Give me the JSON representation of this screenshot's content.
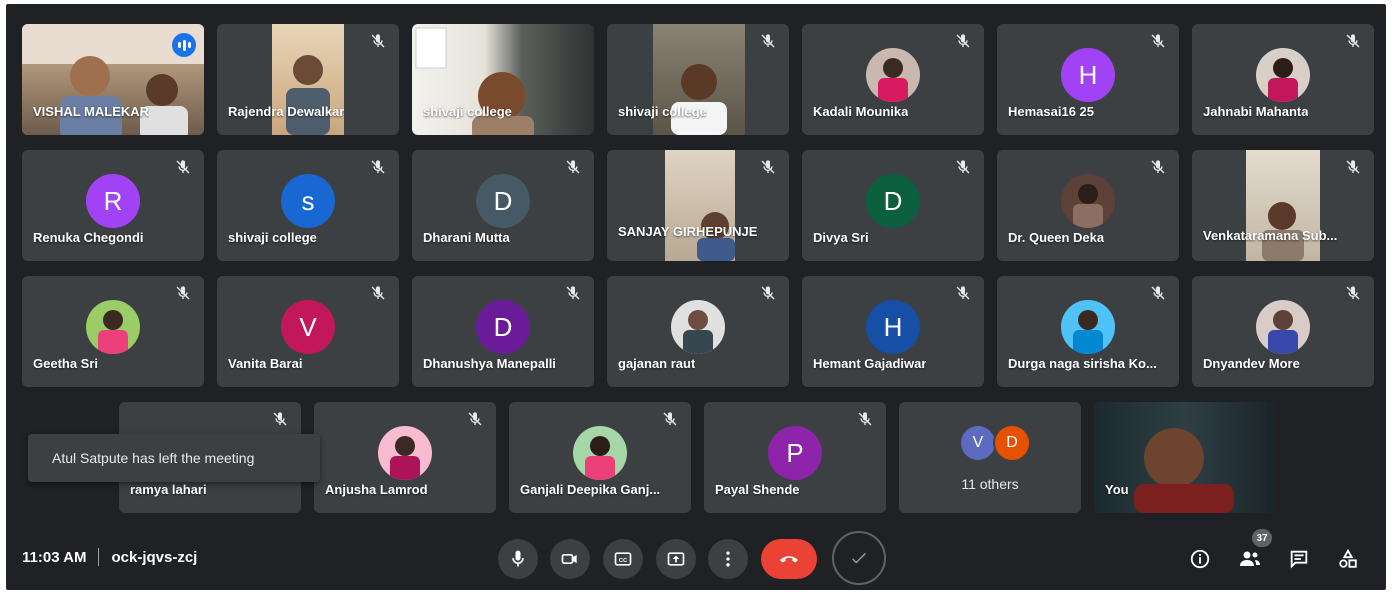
{
  "meeting": {
    "time": "11:03 AM",
    "code": "ock-jqvs-zcj",
    "people_count": "37"
  },
  "toast": "Atul Satpute has left the meeting",
  "tiles": [
    {
      "name": "VISHAL MALEKAR"
    },
    {
      "name": "Rajendra Dewalkar"
    },
    {
      "name": "shivaji college"
    },
    {
      "name": "shivaji college"
    },
    {
      "name": "Kadali Mounika"
    },
    {
      "name": "Hemasai16 25",
      "initial": "H",
      "color": "#a142f4"
    },
    {
      "name": "Jahnabi Mahanta"
    },
    {
      "name": "Renuka Chegondi",
      "initial": "R",
      "color": "#a142f4"
    },
    {
      "name": "shivaji college",
      "initial": "s",
      "color": "#1967d2"
    },
    {
      "name": "Dharani Mutta",
      "initial": "D",
      "color": "#455a64"
    },
    {
      "name": "SANJAY GIRHEPUNJE"
    },
    {
      "name": "Divya Sri",
      "initial": "D",
      "color": "#0b5e3e"
    },
    {
      "name": "Dr. Queen Deka"
    },
    {
      "name": "Venkataramana Sub..."
    },
    {
      "name": "Geetha Sri"
    },
    {
      "name": "Vanita Barai",
      "initial": "V",
      "color": "#c2185b"
    },
    {
      "name": "Dhanushya Manepalli",
      "initial": "D",
      "color": "#6a1b9a"
    },
    {
      "name": "gajanan raut"
    },
    {
      "name": "Hemant Gajadiwar",
      "initial": "H",
      "color": "#174ea6"
    },
    {
      "name": "Durga naga sirisha Ko..."
    },
    {
      "name": "Dnyandev More"
    },
    {
      "name": "ramya lahari"
    },
    {
      "name": "Anjusha Lamrod"
    },
    {
      "name": "Ganjali Deepika Ganj..."
    },
    {
      "name": "Payal Shende",
      "initial": "P",
      "color": "#8e24aa"
    },
    {
      "name": "You"
    }
  ],
  "others": {
    "label": "11 others",
    "avatars": [
      {
        "initial": "V",
        "color": "#5c6bc0"
      },
      {
        "initial": "D",
        "color": "#e65100"
      }
    ]
  },
  "colors": {
    "background": "#202124",
    "tile": "#3c4043",
    "end_call": "#ea4335",
    "active_outline": "#8ab4f8"
  }
}
